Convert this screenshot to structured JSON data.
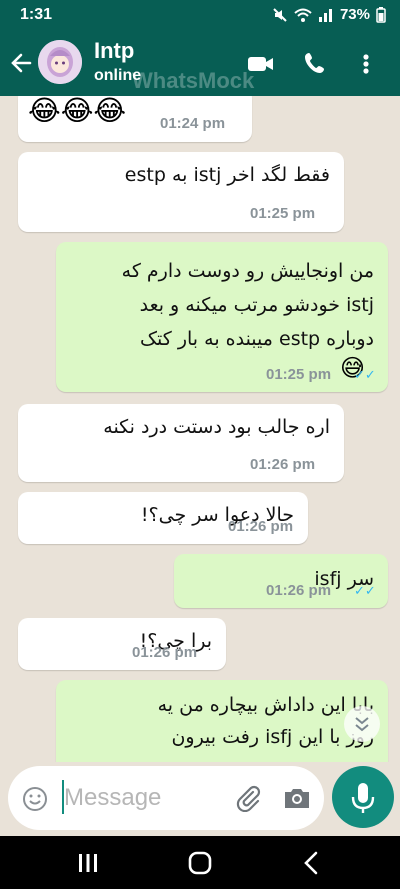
{
  "status_bar": {
    "time": "1:31",
    "battery": "73%"
  },
  "header": {
    "contact_name": "Intp",
    "presence": "online",
    "watermark": "WhatsMock"
  },
  "messages": [
    {
      "dir": "in",
      "emoji": "😂😂😂",
      "time": "01:24 pm"
    },
    {
      "dir": "in",
      "text": "فقط لگد اخر istj به estp",
      "time": "01:25 pm"
    },
    {
      "dir": "out",
      "lines": [
        "من اونجاییش رو دوست دارم که",
        "istj خودشو مرتب میکنه و بعد",
        "دوباره estp میبنده به بار کتک"
      ],
      "emoji": "😅",
      "time": "01:25 pm",
      "status": "read"
    },
    {
      "dir": "in",
      "text": "اره جالب بود دستت درد نکنه",
      "time": "01:26 pm"
    },
    {
      "dir": "in",
      "text": "حالا دعوا سر چی؟!",
      "time": "01:26 pm"
    },
    {
      "dir": "out",
      "text": "سر isfj",
      "time": "01:26 pm",
      "status": "read"
    },
    {
      "dir": "in",
      "text": "برا چی؟!",
      "time": "01:26 pm"
    },
    {
      "dir": "out",
      "lines": [
        "بابا این داداش بیچاره من یه",
        "روز با این isfj رفت بیرون"
      ]
    }
  ],
  "composer": {
    "placeholder": "Message"
  },
  "colors": {
    "header": "#075e54",
    "outgoing_bubble": "#dcf8c6",
    "incoming_bubble": "#ffffff",
    "accent": "#128c7e",
    "read_ticks": "#34b7f1"
  }
}
